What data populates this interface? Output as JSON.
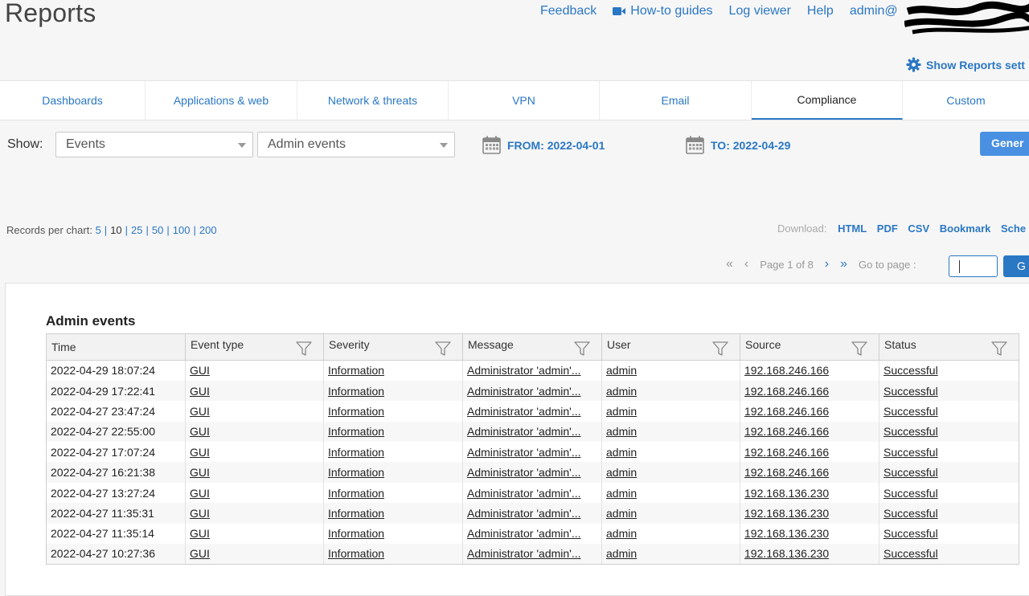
{
  "header": {
    "title": "Reports",
    "nav": {
      "feedback": "Feedback",
      "howto": "How-to guides",
      "logviewer": "Log viewer",
      "help": "Help",
      "admin": "admin@"
    },
    "settings_label": "Show Reports sett"
  },
  "tabs": [
    {
      "label": "Dashboards"
    },
    {
      "label": "Applications & web"
    },
    {
      "label": "Network & threats"
    },
    {
      "label": "VPN"
    },
    {
      "label": "Email"
    },
    {
      "label": "Compliance"
    },
    {
      "label": "Custom"
    }
  ],
  "filters": {
    "show_label": "Show:",
    "select1_value": "Events",
    "select2_value": "Admin events",
    "from": "FROM: 2022-04-01",
    "to": "TO: 2022-04-29",
    "generate_label": "Gener"
  },
  "records": {
    "label": "Records per chart:",
    "options": [
      "5",
      "10",
      "25",
      "50",
      "100",
      "200"
    ],
    "current": "10"
  },
  "download": {
    "label": "Download:",
    "links": [
      "HTML",
      "PDF",
      "CSV",
      "Bookmark",
      "Sche"
    ]
  },
  "pager": {
    "page": "Page",
    "current": "1",
    "of": "of",
    "total": "8",
    "goto_label": "Go to page :",
    "go_label": "G"
  },
  "report": {
    "title": "Admin events",
    "columns": [
      "Time",
      "Event type",
      "Severity",
      "Message",
      "User",
      "Source",
      "Status"
    ],
    "rows": [
      [
        "2022-04-29 18:07:24",
        "GUI",
        "Information",
        "Administrator 'admin'...",
        "admin",
        "192.168.246.166",
        "Successful"
      ],
      [
        "2022-04-29 17:22:41",
        "GUI",
        "Information",
        "Administrator 'admin'...",
        "admin",
        "192.168.246.166",
        "Successful"
      ],
      [
        "2022-04-27 23:47:24",
        "GUI",
        "Information",
        "Administrator 'admin'...",
        "admin",
        "192.168.246.166",
        "Successful"
      ],
      [
        "2022-04-27 22:55:00",
        "GUI",
        "Information",
        "Administrator 'admin'...",
        "admin",
        "192.168.246.166",
        "Successful"
      ],
      [
        "2022-04-27 17:07:24",
        "GUI",
        "Information",
        "Administrator 'admin'...",
        "admin",
        "192.168.246.166",
        "Successful"
      ],
      [
        "2022-04-27 16:21:38",
        "GUI",
        "Information",
        "Administrator 'admin'...",
        "admin",
        "192.168.246.166",
        "Successful"
      ],
      [
        "2022-04-27 13:27:24",
        "GUI",
        "Information",
        "Administrator 'admin'...",
        "admin",
        "192.168.136.230",
        "Successful"
      ],
      [
        "2022-04-27 11:35:31",
        "GUI",
        "Information",
        "Administrator 'admin'...",
        "admin",
        "192.168.136.230",
        "Successful"
      ],
      [
        "2022-04-27 11:35:14",
        "GUI",
        "Information",
        "Administrator 'admin'...",
        "admin",
        "192.168.136.230",
        "Successful"
      ],
      [
        "2022-04-27 10:27:36",
        "GUI",
        "Information",
        "Administrator 'admin'...",
        "admin",
        "192.168.136.230",
        "Successful"
      ]
    ]
  },
  "colors": {
    "accent": "#2a77c4",
    "button": "#4a90e2"
  }
}
